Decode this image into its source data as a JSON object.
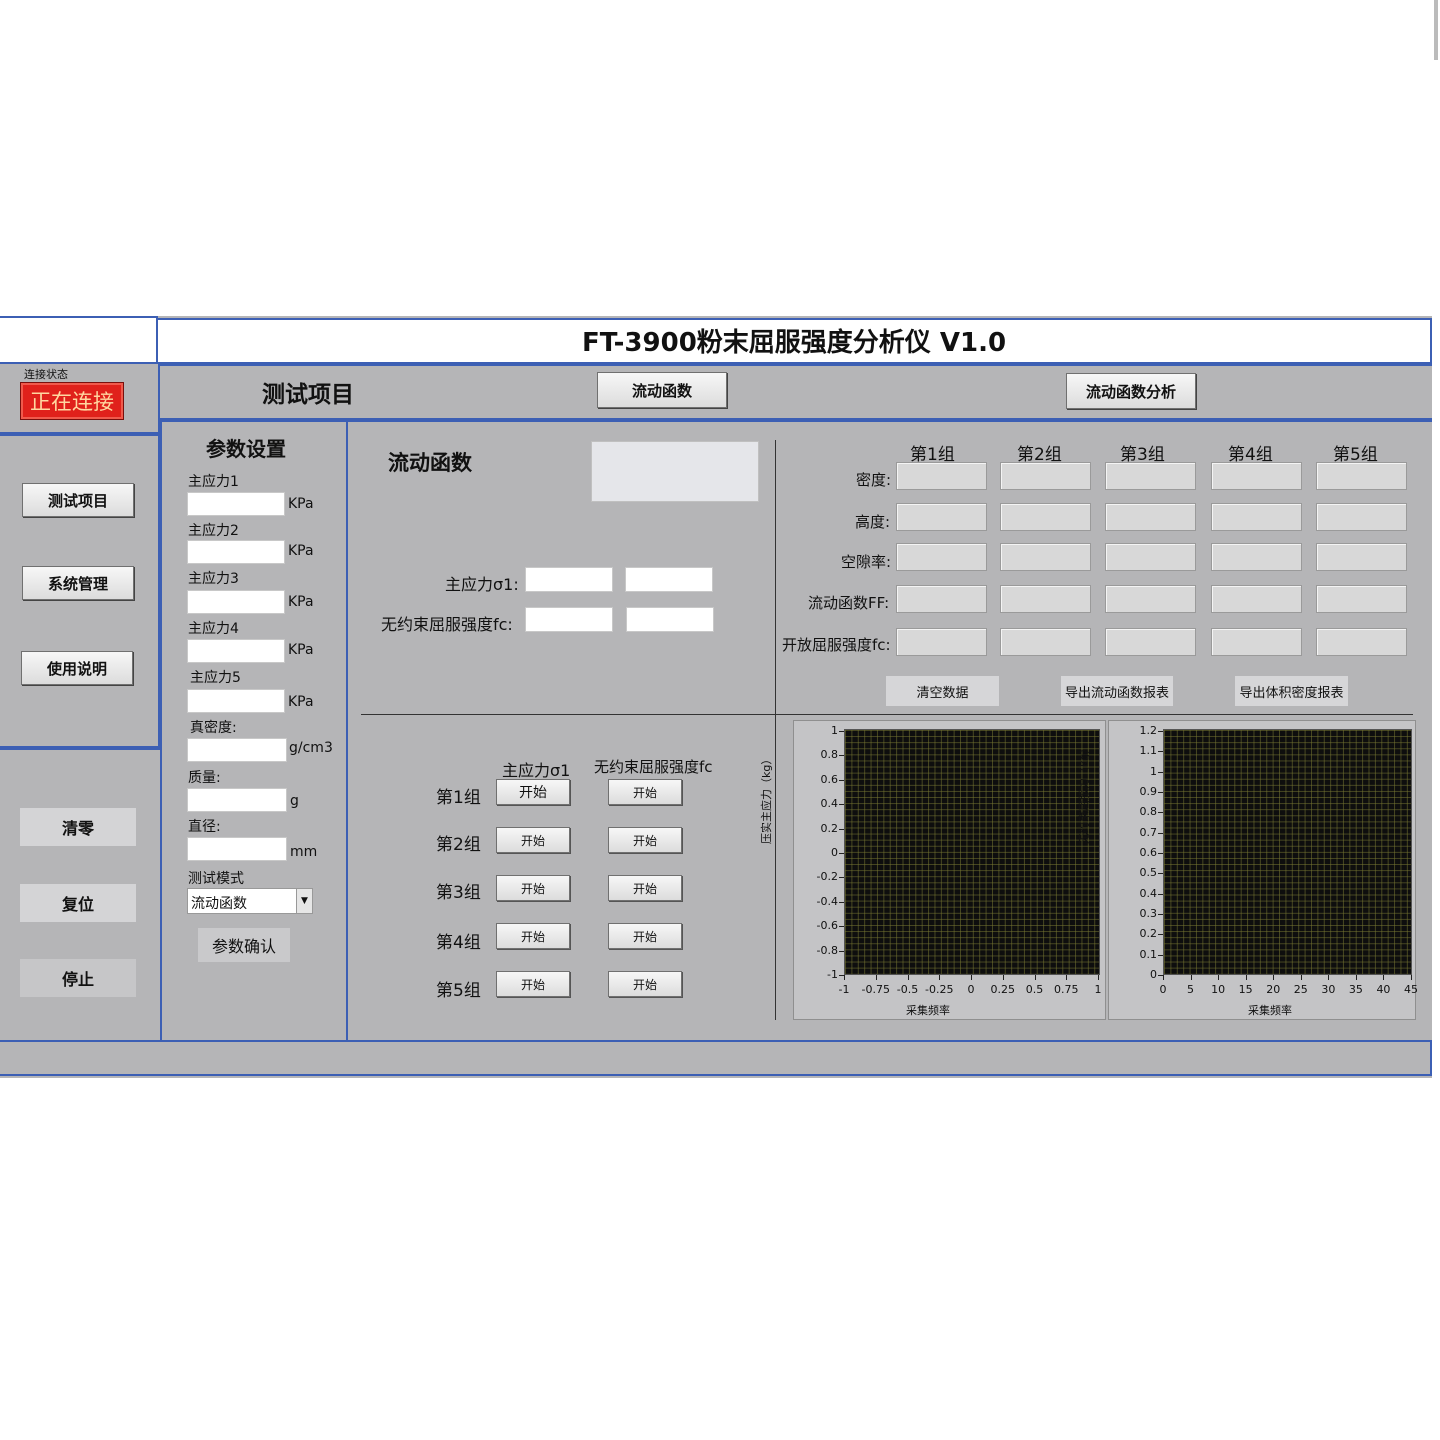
{
  "app_title": "FT-3900粉末屈服强度分析仪 V1.0",
  "connection": {
    "caption": "连接状态",
    "status": "正在连接",
    "status_color": "#e0211b"
  },
  "sidebar": {
    "nav": [
      "测试项目",
      "系统管理",
      "使用说明"
    ],
    "controls": [
      "清零",
      "复位",
      "停止"
    ]
  },
  "header": {
    "section_title": "测试项目",
    "btn_flow": "流动函数",
    "btn_flow_analysis": "流动函数分析"
  },
  "params": {
    "title": "参数设置",
    "fields": [
      {
        "label": "主应力1",
        "unit": "KPa",
        "value": ""
      },
      {
        "label": "主应力2",
        "unit": "KPa",
        "value": ""
      },
      {
        "label": "主应力3",
        "unit": "KPa",
        "value": ""
      },
      {
        "label": "主应力4",
        "unit": "KPa",
        "value": ""
      },
      {
        "label": "主应力5",
        "unit": "KPa",
        "value": ""
      },
      {
        "label": "真密度:",
        "unit": "g/cm3",
        "value": ""
      },
      {
        "label": "质量:",
        "unit": "g",
        "value": ""
      },
      {
        "label": "直径:",
        "unit": "mm",
        "value": ""
      }
    ],
    "mode_label": "测试模式",
    "mode_value": "流动函数",
    "confirm": "参数确认"
  },
  "flow": {
    "title": "流动函数",
    "sigma_label": "主应力σ1:",
    "fc_label": "无约束屈服强度fc:"
  },
  "groups": {
    "col1": "主应力σ1",
    "col2": "无约束屈服强度fc",
    "rows": [
      "第1组",
      "第2组",
      "第3组",
      "第4组",
      "第5组"
    ],
    "start": "开始"
  },
  "results": {
    "columns": [
      "第1组",
      "第2组",
      "第3组",
      "第4组",
      "第5组"
    ],
    "rows": [
      "密度:",
      "高度:",
      "空隙率:",
      "流动函数FF:",
      "开放屈服强度fc:"
    ],
    "btn_clear": "清空数据",
    "btn_export_flow": "导出流动函数报表",
    "btn_export_density": "导出体积密度报表"
  },
  "chart_data": [
    {
      "type": "line",
      "xlabel": "采集频率",
      "ylabel": "压实主应力（kg）",
      "x_ticks": [
        "-1",
        "-0.75",
        "-0.5",
        "-0.25",
        "0",
        "0.25",
        "0.5",
        "0.75",
        "1"
      ],
      "y_ticks": [
        "1",
        "0.8",
        "0.6",
        "0.4",
        "0.2",
        "0",
        "-0.2",
        "-0.4",
        "-0.6",
        "-0.8",
        "-1"
      ],
      "xlim": [
        -1,
        1
      ],
      "ylim": [
        -1,
        1
      ],
      "series": [],
      "grid": true,
      "background": "#0e0e0e"
    },
    {
      "type": "line",
      "xlabel": "采集频率",
      "ylabel": "无约束屈服力（kg）",
      "x_ticks": [
        "0",
        "5",
        "10",
        "15",
        "20",
        "25",
        "30",
        "35",
        "40",
        "45"
      ],
      "y_ticks": [
        "1.2",
        "1.1",
        "1",
        "0.9",
        "0.8",
        "0.7",
        "0.6",
        "0.5",
        "0.4",
        "0.3",
        "0.2",
        "0.1",
        "0"
      ],
      "xlim": [
        0,
        45
      ],
      "ylim": [
        0,
        1.2
      ],
      "series": [],
      "grid": true,
      "background": "#0e0e0e"
    }
  ]
}
